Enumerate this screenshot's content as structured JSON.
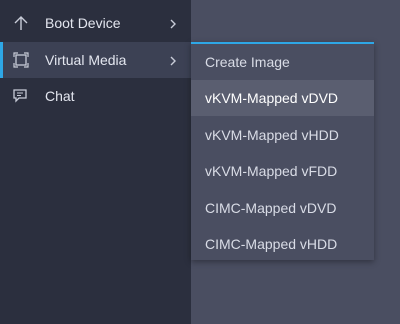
{
  "sidebar": {
    "items": [
      {
        "label": "Boot Device",
        "icon": "arrow-up-icon",
        "has_submenu": true,
        "active": false
      },
      {
        "label": "Virtual Media",
        "icon": "virtual-media-icon",
        "has_submenu": true,
        "active": true
      },
      {
        "label": "Chat",
        "icon": "chat-icon",
        "has_submenu": false,
        "active": false
      }
    ]
  },
  "submenu": {
    "items": [
      {
        "label": "Create Image"
      },
      {
        "label": "vKVM-Mapped vDVD",
        "hovered": true
      },
      {
        "label": "vKVM-Mapped vHDD"
      },
      {
        "label": "vKVM-Mapped vFDD"
      },
      {
        "label": "CIMC-Mapped vDVD"
      },
      {
        "label": "CIMC-Mapped vHDD"
      }
    ]
  },
  "colors": {
    "sidebar_bg": "#2b2f3e",
    "active_bg": "#3c4154",
    "accent": "#2ea7e6",
    "submenu_bg": "#4a4e61",
    "hover_bg": "#5a5e70"
  }
}
